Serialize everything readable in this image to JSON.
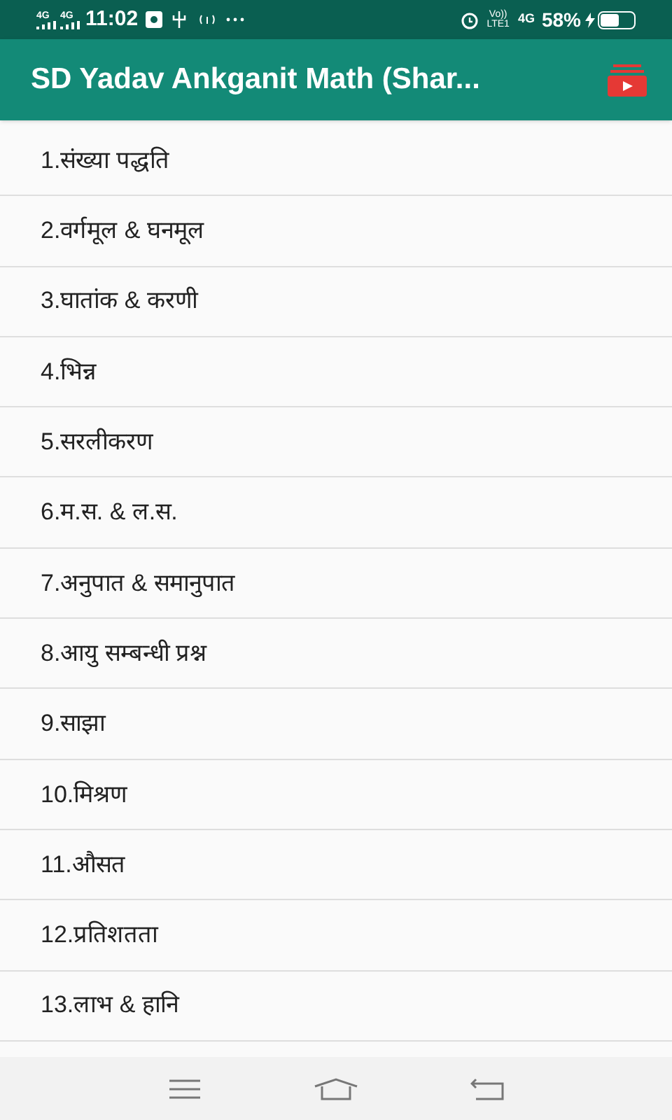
{
  "status_bar": {
    "network_1": "4G",
    "network_2": "4G",
    "time": "11:02",
    "volte": "Vo))",
    "lte": "LTE1",
    "network_3": "4G",
    "battery": "58%"
  },
  "app_bar": {
    "title": "SD Yadav Ankganit Math (Shar..."
  },
  "chapters": [
    {
      "label": "1.संख्या पद्धति"
    },
    {
      "label": "2.वर्गमूल & घनमूल"
    },
    {
      "label": "3.घातांक & करणी"
    },
    {
      "label": "4.भिन्न"
    },
    {
      "label": "5.सरलीकरण"
    },
    {
      "label": "6.म.स. & ल.स."
    },
    {
      "label": "7.अनुपात & समानुपात"
    },
    {
      "label": "8.आयु सम्बन्धी प्रश्न"
    },
    {
      "label": "9.साझा"
    },
    {
      "label": "10.मिश्रण"
    },
    {
      "label": "11.औसत"
    },
    {
      "label": "12.प्रतिशतता"
    },
    {
      "label": "13.लाभ & हानि"
    }
  ]
}
